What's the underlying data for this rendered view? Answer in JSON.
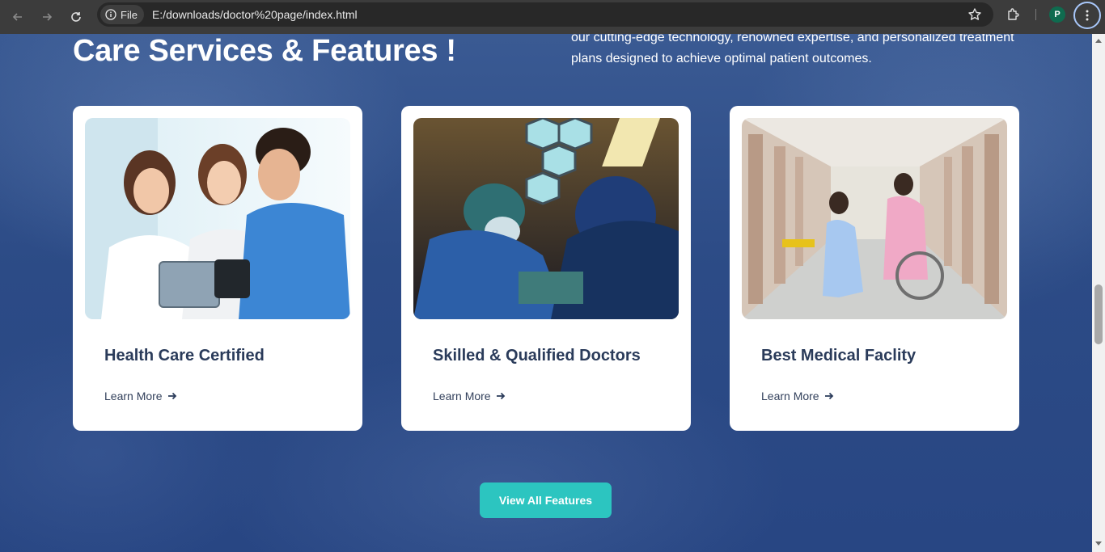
{
  "browser": {
    "file_label": "File",
    "url": "E:/downloads/doctor%20page/index.html",
    "profile_initial": "P"
  },
  "section": {
    "title": "Care Services & Features !",
    "description": "our cutting-edge technology, renowned expertise, and personalized treatment plans designed to achieve optimal patient outcomes."
  },
  "cards": [
    {
      "title": "Health Care Certified",
      "link": "Learn More",
      "image": "doctors-with-tablet"
    },
    {
      "title": "Skilled & Qualified Doctors",
      "link": "Learn More",
      "image": "surgeons-operating"
    },
    {
      "title": "Best Medical Faclity",
      "link": "Learn More",
      "image": "nurse-with-patient-wheelchair"
    }
  ],
  "cta_label": "View All Features",
  "colors": {
    "accent": "#2cc5c0",
    "background": "#2c4b86",
    "card_title": "#2a3b5a"
  }
}
